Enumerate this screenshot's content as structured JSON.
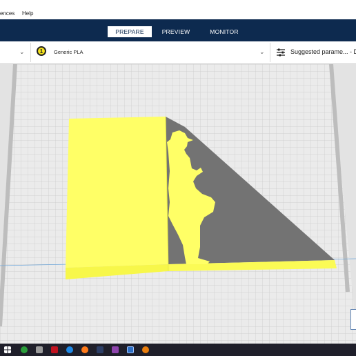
{
  "menubar": {
    "items": [
      "ences",
      "Help"
    ]
  },
  "nav": {
    "tabs": [
      {
        "label": "PREPARE",
        "active": true
      },
      {
        "label": "PREVIEW",
        "active": false
      },
      {
        "label": "MONITOR",
        "active": false
      }
    ]
  },
  "settings_bar": {
    "extruder_number": "1",
    "material": "Generic PLA",
    "print_settings": "Suggested parame... - Dra"
  },
  "colors": {
    "nav_bg": "#0d2a4f",
    "model_yellow": "#ffff66",
    "shadow_gray": "#737373",
    "build_plate": "#e6e6e6"
  },
  "icons": {
    "material_chevron": "chevron-down-icon",
    "print_settings_chevron": "chevron-down-icon",
    "extruder": "extruder-icon",
    "settings": "sliders-icon",
    "taskbar": [
      "windows-start-icon",
      "xbox-icon",
      "file-explorer-icon",
      "netflix-icon",
      "edge-icon",
      "firefox-icon",
      "steam-icon",
      "game-icon",
      "cura-icon",
      "blender-icon"
    ]
  }
}
